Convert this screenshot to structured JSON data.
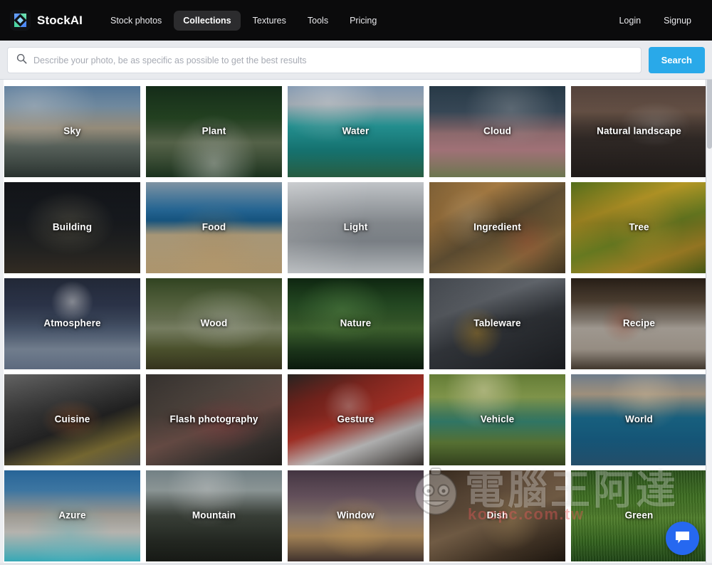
{
  "header": {
    "brand_name": "StockAI",
    "logo_icon": "stockai-logo-icon",
    "nav": [
      {
        "label": "Stock photos",
        "active": false
      },
      {
        "label": "Collections",
        "active": true
      },
      {
        "label": "Textures",
        "active": false
      },
      {
        "label": "Tools",
        "active": false
      },
      {
        "label": "Pricing",
        "active": false
      }
    ],
    "auth": [
      {
        "label": "Login"
      },
      {
        "label": "Signup"
      }
    ]
  },
  "search": {
    "icon": "search-icon",
    "placeholder": "Describe your photo, be as specific as possible to get the best results",
    "value": "",
    "button_label": "Search",
    "button_color": "#29a9e9"
  },
  "collections": {
    "tiles": [
      {
        "label": "Sky",
        "theme": "sky"
      },
      {
        "label": "Plant",
        "theme": "plant"
      },
      {
        "label": "Water",
        "theme": "water"
      },
      {
        "label": "Cloud",
        "theme": "cloud"
      },
      {
        "label": "Natural landscape",
        "theme": "natural-landscape"
      },
      {
        "label": "Building",
        "theme": "building"
      },
      {
        "label": "Food",
        "theme": "food"
      },
      {
        "label": "Light",
        "theme": "light"
      },
      {
        "label": "Ingredient",
        "theme": "ingredient"
      },
      {
        "label": "Tree",
        "theme": "tree"
      },
      {
        "label": "Atmosphere",
        "theme": "atmosphere"
      },
      {
        "label": "Wood",
        "theme": "wood"
      },
      {
        "label": "Nature",
        "theme": "nature"
      },
      {
        "label": "Tableware",
        "theme": "tableware"
      },
      {
        "label": "Recipe",
        "theme": "recipe"
      },
      {
        "label": "Cuisine",
        "theme": "cuisine"
      },
      {
        "label": "Flash photography",
        "theme": "flash-photography"
      },
      {
        "label": "Gesture",
        "theme": "gesture"
      },
      {
        "label": "Vehicle",
        "theme": "vehicle"
      },
      {
        "label": "World",
        "theme": "world"
      },
      {
        "label": "Azure",
        "theme": "azure"
      },
      {
        "label": "Mountain",
        "theme": "mountain"
      },
      {
        "label": "Window",
        "theme": "window"
      },
      {
        "label": "Dish",
        "theme": "dish"
      },
      {
        "label": "Green",
        "theme": "green"
      }
    ]
  },
  "watermark": {
    "cjk_text": "電腦王阿達",
    "url_text": "kocpc.com.tw",
    "face_icon": "mascot-face-icon"
  },
  "chat": {
    "icon": "chat-bubble-icon",
    "color": "#2668f0"
  }
}
